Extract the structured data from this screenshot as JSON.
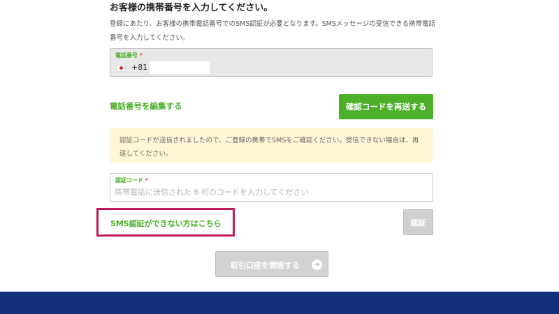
{
  "form": {
    "heading": "お客様の携帯番号を入力してください。",
    "description": "登録にあたり、お客様の携帯電話番号でのSMS認証が必要となります。SMSメッセージの受信できる携帯電話番号を入力してください。",
    "phone": {
      "label": "電話番号",
      "required_mark": "*",
      "country_code": "+81",
      "flag_icon": "japan-flag-icon"
    },
    "edit_phone_link": "電話番号を編集する",
    "resend_button": "確認コードを再送する",
    "notice": "認証コードが送信されましたので、ご登録の携帯でSMSをご確認ください。受信できない場合は、再送してください。",
    "code": {
      "label": "認証コード",
      "required_mark": "*",
      "placeholder": "携帯電話に送信された 6 桁のコードを入力してください"
    },
    "sms_unavailable_link": "SMS認証ができない方はこちら",
    "verify_button": "認証",
    "open_account_button": "取引口座を開設する",
    "open_account_icon": "arrow-right-circle-icon"
  },
  "colors": {
    "accent_green": "#4caf2a",
    "highlight_border": "#c2185b",
    "notice_bg": "#fff5d7",
    "footer_band": "#15307a",
    "disabled_button": "#d0d0d0"
  }
}
